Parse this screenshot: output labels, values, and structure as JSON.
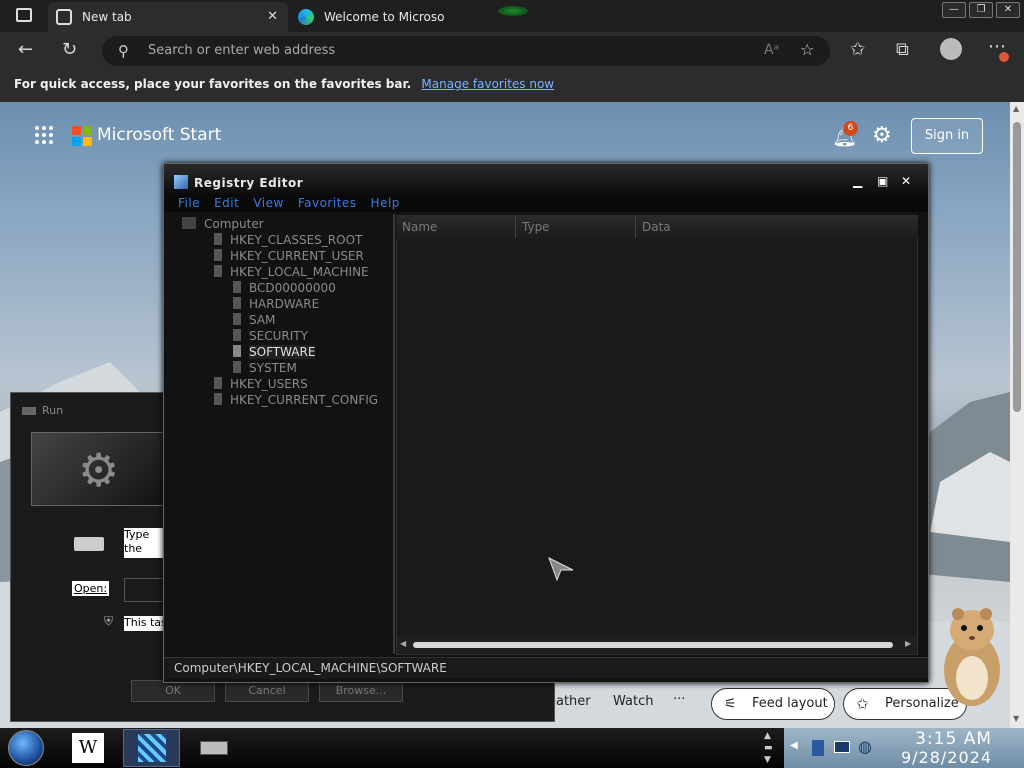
{
  "browser": {
    "tabs": [
      {
        "label": "New tab",
        "active": true
      },
      {
        "label": "Welcome to Microso",
        "active": false
      }
    ],
    "address_placeholder": "Search or enter web address",
    "favbar_text": "For quick access, place your favorites on the favorites bar.",
    "favbar_link": "Manage favorites now"
  },
  "ms_start": {
    "title": "Microsoft Start",
    "notification_count": "6",
    "sign_in": "Sign in",
    "bottom": {
      "weather": "eather",
      "watch": "Watch",
      "more": "···",
      "feed_layout": "Feed layout",
      "personalize": "Personalize"
    },
    "colors": {
      "logo_red": "#f25022",
      "logo_green": "#7fba00",
      "logo_blue": "#00a4ef",
      "logo_yellow": "#ffb900"
    }
  },
  "run_dialog": {
    "title": "Run",
    "description": "Type the name of a program, folder, document, or Internet resource",
    "open_label": "Open:",
    "task_text": "This task will be created with administrative privileges.",
    "buttons": [
      "OK",
      "Cancel",
      "Browse..."
    ]
  },
  "registry_editor": {
    "title": "Registry Editor",
    "menu": [
      "File",
      "Edit",
      "View",
      "Favorites",
      "Help"
    ],
    "tree": [
      {
        "label": "Computer",
        "level": 0
      },
      {
        "label": "HKEY_CLASSES_ROOT",
        "level": 1
      },
      {
        "label": "HKEY_CURRENT_USER",
        "level": 1
      },
      {
        "label": "HKEY_LOCAL_MACHINE",
        "level": 1
      },
      {
        "label": "BCD00000000",
        "level": 2
      },
      {
        "label": "HARDWARE",
        "level": 2
      },
      {
        "label": "SAM",
        "level": 2
      },
      {
        "label": "SECURITY",
        "level": 2
      },
      {
        "label": "SOFTWARE",
        "level": 2,
        "selected": true
      },
      {
        "label": "SYSTEM",
        "level": 2
      },
      {
        "label": "HKEY_USERS",
        "level": 1
      },
      {
        "label": "HKEY_CURRENT_CONFIG",
        "level": 1
      }
    ],
    "columns": [
      "Name",
      "Type",
      "Data"
    ],
    "status_path": "Computer\\HKEY_LOCAL_MACHINE\\SOFTWARE",
    "menu_color": "#3a7be0"
  },
  "taskbar": {
    "time": "3:15 AM",
    "date": "9/28/2024",
    "wiki_label": "W"
  }
}
